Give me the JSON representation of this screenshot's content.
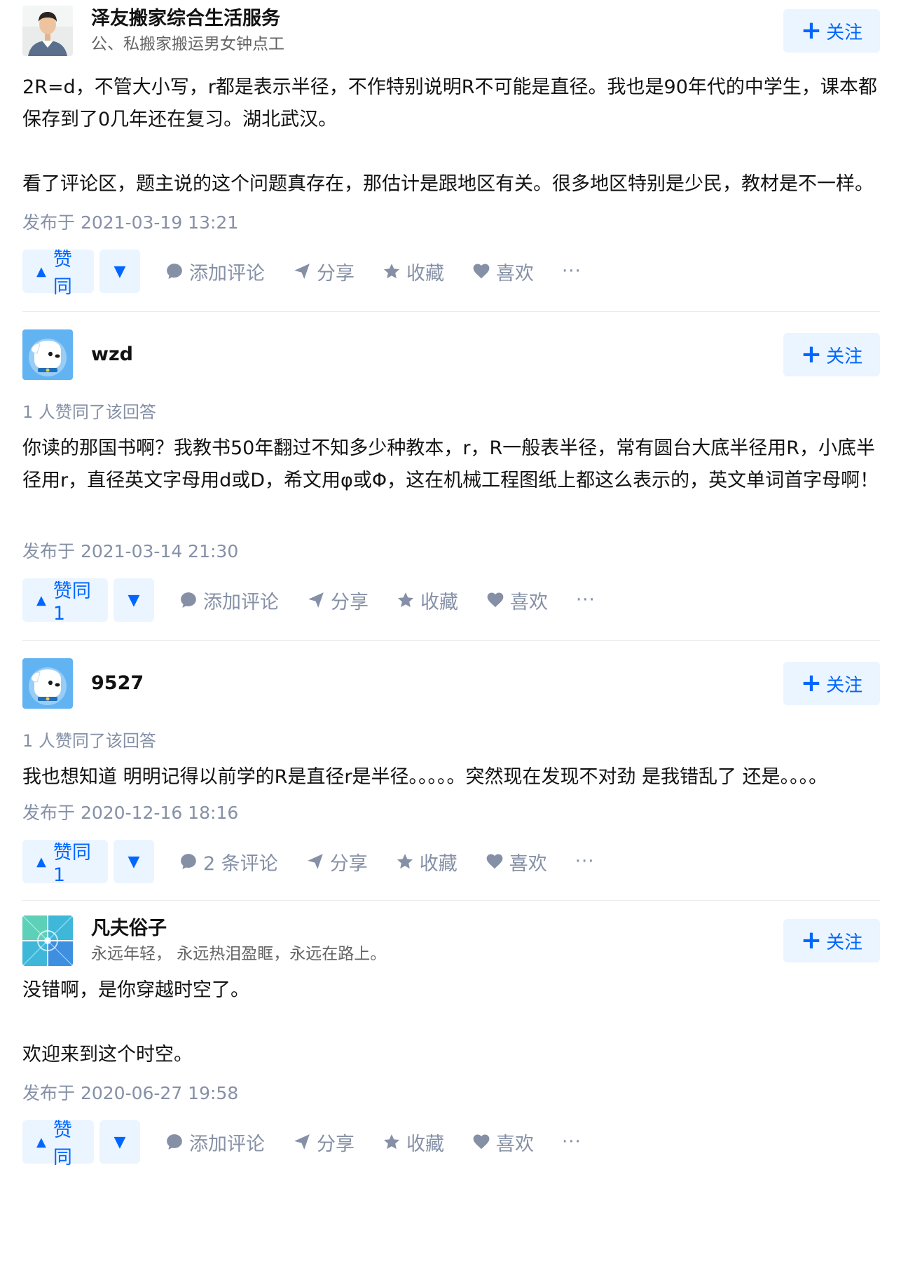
{
  "answers": [
    {
      "author": {
        "name": "泽友搬家综合生活服务",
        "bio": "公、私搬家搬运男女钟点工",
        "avatar": "man-photo-avatar"
      },
      "follow_label": "关注",
      "vote_count_text": "",
      "paragraphs": [
        "2R=d，不管大小写，r都是表示半径，不作特别说明R不可能是直径。我也是90年代的中学生，课本都保存到了0几年还在复习。湖北武汉。",
        "",
        "看了评论区，题主说的这个问题真存在，那估计是跟地区有关。很多地区特别是少民，教材是不一样。"
      ],
      "time": "发布于 2021-03-19 13:21",
      "actions": {
        "upvote": "赞同",
        "comment": "添加评论",
        "share": "分享",
        "collect": "收藏",
        "like": "喜欢",
        "more": "···"
      }
    },
    {
      "author": {
        "name": "wzd",
        "bio": "",
        "avatar": "default-dog-avatar"
      },
      "follow_label": "关注",
      "vote_count_text": "1 人赞同了该回答",
      "paragraphs": [
        "你读的那国书啊？我教书50年翻过不知多少种教本，r，R一般表半径，常有圆台大底半径用R，小底半径用r，直径英文字母用d或D，希文用φ或Φ，这在机械工程图纸上都这么表示的，英文单词首字母啊！",
        ""
      ],
      "time": "发布于 2021-03-14 21:30",
      "actions": {
        "upvote": "赞同 1",
        "comment": "添加评论",
        "share": "分享",
        "collect": "收藏",
        "like": "喜欢",
        "more": "···"
      }
    },
    {
      "author": {
        "name": "9527",
        "bio": "",
        "avatar": "default-dog-avatar"
      },
      "follow_label": "关注",
      "vote_count_text": "1 人赞同了该回答",
      "paragraphs": [
        "我也想知道 明明记得以前学的R是直径r是半径。。。。。突然现在发现不对劲 是我错乱了 还是。。。。"
      ],
      "time": "发布于 2020-12-16 18:16",
      "actions": {
        "upvote": "赞同 1",
        "comment": "2 条评论",
        "share": "分享",
        "collect": "收藏",
        "like": "喜欢",
        "more": "···"
      }
    },
    {
      "author": {
        "name": "凡夫俗子",
        "bio": "永远年轻， 永远热泪盈眶，永远在路上。",
        "avatar": "abstract-pattern-avatar"
      },
      "follow_label": "关注",
      "vote_count_text": "",
      "paragraphs": [
        "没错啊，是你穿越时空了。",
        "",
        "欢迎来到这个时空。"
      ],
      "time": "发布于 2020-06-27 19:58",
      "actions": {
        "upvote": "赞同",
        "comment": "添加评论",
        "share": "分享",
        "collect": "收藏",
        "like": "喜欢",
        "more": "···"
      }
    }
  ]
}
